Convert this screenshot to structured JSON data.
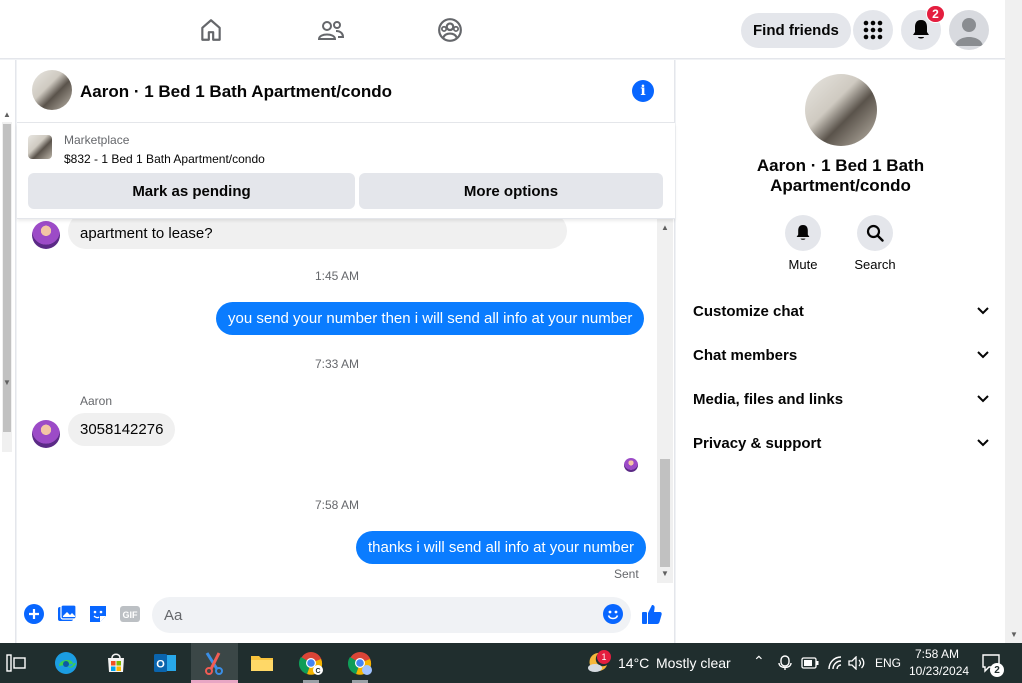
{
  "topnav": {
    "find_friends": "Find friends",
    "notification_count": "2"
  },
  "chat": {
    "title": "Aaron · 1 Bed 1 Bath Apartment/condo",
    "marketplace": {
      "label": "Marketplace",
      "description": "$832 - 1 Bed 1 Bath Apartment/condo",
      "mark_pending": "Mark as pending",
      "more_options": "More options"
    },
    "messages": [
      {
        "text": "apartment to lease?"
      },
      {
        "time": "1:45 AM"
      },
      {
        "text": "you send your number then i will send all info at your number"
      },
      {
        "time": "7:33 AM"
      },
      {
        "sender": "Aaron",
        "text": "3058142276"
      },
      {
        "time": "7:58 AM"
      },
      {
        "text": "thanks i will send all info at your number",
        "status": "Sent"
      }
    ],
    "composer_placeholder": "Aa"
  },
  "info_panel": {
    "title_line1": "Aaron · 1 Bed 1 Bath",
    "title_line2": "Apartment/condo",
    "mute": "Mute",
    "search": "Search",
    "sections": [
      "Customize chat",
      "Chat members",
      "Media, files and links",
      "Privacy & support"
    ]
  },
  "taskbar": {
    "weather_temp": "14°C",
    "weather_desc": "Mostly clear",
    "weather_badge": "1",
    "language": "ENG",
    "time": "7:58 AM",
    "date": "10/23/2024",
    "notif_count": "2"
  },
  "colors": {
    "accent": "#0866ff",
    "bubble_out": "#0a7cff",
    "badge": "#e41e3f",
    "taskbar": "#202e2e"
  }
}
